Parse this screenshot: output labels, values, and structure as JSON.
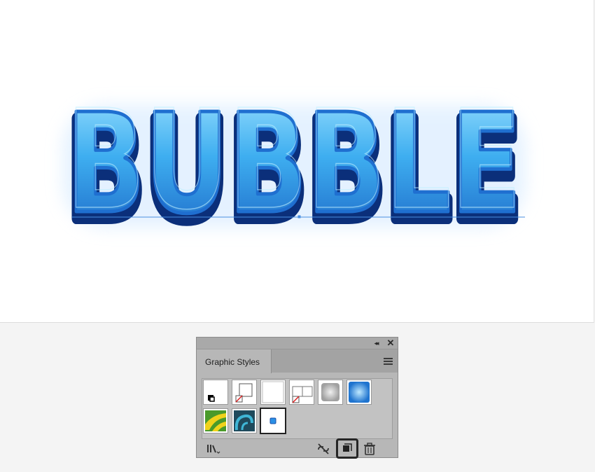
{
  "artboard": {
    "text": "BUBBLE",
    "colors": {
      "fill_light": "#8fdcff",
      "fill_mid": "#2f9fe8",
      "fill_dark": "#1558b8",
      "stroke": "#0b2f7a",
      "glow": "#d5ecff"
    }
  },
  "panel": {
    "tab_label": "Graphic Styles",
    "top_controls": {
      "collapse": "◂◂",
      "close": "✕"
    },
    "icons": {
      "menu": "hamburger-menu-icon",
      "library": "graphic-styles-library-icon",
      "break_link": "break-link-icon",
      "new_style": "new-graphic-style-icon",
      "delete": "trash-icon"
    },
    "swatches": [
      {
        "name": "default-graphic-style"
      },
      {
        "name": "basic-graphic-style-shadow"
      },
      {
        "name": "plain-white-style"
      },
      {
        "name": "double-box-style"
      },
      {
        "name": "grey-bevel-style"
      },
      {
        "name": "blue-gradient-style"
      },
      {
        "name": "green-yellow-pattern-style"
      },
      {
        "name": "blue-teal-pattern-style"
      },
      {
        "name": "bubble-style"
      }
    ],
    "selected_swatch": "bubble-style"
  }
}
